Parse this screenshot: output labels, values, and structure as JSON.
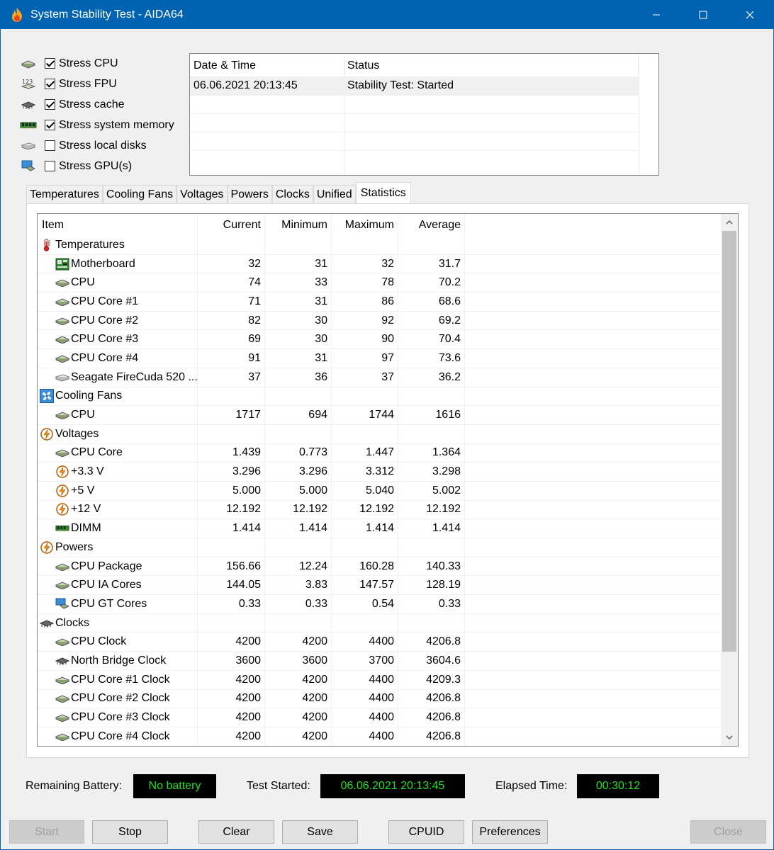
{
  "window": {
    "title": "System Stability Test - AIDA64",
    "controls": [
      "minimize-icon",
      "maximize-icon",
      "close-icon"
    ]
  },
  "stress": [
    {
      "label": "Stress CPU",
      "checked": true,
      "icon": "cpu-chip-icon"
    },
    {
      "label": "Stress FPU",
      "checked": true,
      "icon": "fpu-123-icon"
    },
    {
      "label": "Stress cache",
      "checked": true,
      "icon": "cache-chip-icon"
    },
    {
      "label": "Stress system memory",
      "checked": true,
      "icon": "memory-module-icon"
    },
    {
      "label": "Stress local disks",
      "checked": false,
      "icon": "disk-drive-icon"
    },
    {
      "label": "Stress GPU(s)",
      "checked": false,
      "icon": "gpu-monitor-icon"
    }
  ],
  "log": {
    "headers": [
      "Date & Time",
      "Status"
    ],
    "rows": [
      {
        "datetime": "06.06.2021 20:13:45",
        "status": "Stability Test: Started"
      }
    ]
  },
  "tabs": [
    "Temperatures",
    "Cooling Fans",
    "Voltages",
    "Powers",
    "Clocks",
    "Unified",
    "Statistics"
  ],
  "active_tab": "Statistics",
  "stats": {
    "headers": [
      "Item",
      "Current",
      "Minimum",
      "Maximum",
      "Average"
    ],
    "rows": [
      {
        "group": true,
        "icon": "thermometer-icon",
        "item": "Temperatures"
      },
      {
        "icon": "motherboard-icon",
        "item": "Motherboard",
        "cur": "32",
        "min": "31",
        "max": "32",
        "avg": "31.7"
      },
      {
        "icon": "cpu-chip-icon",
        "item": "CPU",
        "cur": "74",
        "min": "33",
        "max": "78",
        "avg": "70.2"
      },
      {
        "icon": "cpu-chip-icon",
        "item": "CPU Core #1",
        "cur": "71",
        "min": "31",
        "max": "86",
        "avg": "68.6"
      },
      {
        "icon": "cpu-chip-icon",
        "item": "CPU Core #2",
        "cur": "82",
        "min": "30",
        "max": "92",
        "avg": "69.2"
      },
      {
        "icon": "cpu-chip-icon",
        "item": "CPU Core #3",
        "cur": "69",
        "min": "30",
        "max": "90",
        "avg": "70.4"
      },
      {
        "icon": "cpu-chip-icon",
        "item": "CPU Core #4",
        "cur": "91",
        "min": "31",
        "max": "97",
        "avg": "73.6"
      },
      {
        "icon": "disk-drive-icon",
        "item": "Seagate FireCuda 520 ...",
        "cur": "37",
        "min": "36",
        "max": "37",
        "avg": "36.2"
      },
      {
        "group": true,
        "icon": "fan-icon",
        "item": "Cooling Fans"
      },
      {
        "icon": "cpu-chip-icon",
        "item": "CPU",
        "cur": "1717",
        "min": "694",
        "max": "1744",
        "avg": "1616"
      },
      {
        "group": true,
        "icon": "lightning-icon",
        "item": "Voltages"
      },
      {
        "icon": "cpu-chip-icon",
        "item": "CPU Core",
        "cur": "1.439",
        "min": "0.773",
        "max": "1.447",
        "avg": "1.364"
      },
      {
        "icon": "lightning-icon",
        "item": "+3.3 V",
        "cur": "3.296",
        "min": "3.296",
        "max": "3.312",
        "avg": "3.298"
      },
      {
        "icon": "lightning-icon",
        "item": "+5 V",
        "cur": "5.000",
        "min": "5.000",
        "max": "5.040",
        "avg": "5.002"
      },
      {
        "icon": "lightning-icon",
        "item": "+12 V",
        "cur": "12.192",
        "min": "12.192",
        "max": "12.192",
        "avg": "12.192"
      },
      {
        "icon": "memory-module-icon",
        "item": "DIMM",
        "cur": "1.414",
        "min": "1.414",
        "max": "1.414",
        "avg": "1.414"
      },
      {
        "group": true,
        "icon": "lightning-icon",
        "item": "Powers"
      },
      {
        "icon": "cpu-chip-icon",
        "item": "CPU Package",
        "cur": "156.66",
        "min": "12.24",
        "max": "160.28",
        "avg": "140.33"
      },
      {
        "icon": "cpu-chip-icon",
        "item": "CPU IA Cores",
        "cur": "144.05",
        "min": "3.83",
        "max": "147.57",
        "avg": "128.19"
      },
      {
        "icon": "gpu-monitor-icon",
        "item": "CPU GT Cores",
        "cur": "0.33",
        "min": "0.33",
        "max": "0.54",
        "avg": "0.33"
      },
      {
        "group": true,
        "icon": "cache-chip-icon",
        "item": "Clocks"
      },
      {
        "icon": "cpu-chip-icon",
        "item": "CPU Clock",
        "cur": "4200",
        "min": "4200",
        "max": "4400",
        "avg": "4206.8"
      },
      {
        "icon": "cache-chip-icon",
        "item": "North Bridge Clock",
        "cur": "3600",
        "min": "3600",
        "max": "3700",
        "avg": "3604.6"
      },
      {
        "icon": "cpu-chip-icon",
        "item": "CPU Core #1 Clock",
        "cur": "4200",
        "min": "4200",
        "max": "4400",
        "avg": "4209.3"
      },
      {
        "icon": "cpu-chip-icon",
        "item": "CPU Core #2 Clock",
        "cur": "4200",
        "min": "4200",
        "max": "4400",
        "avg": "4206.8"
      },
      {
        "icon": "cpu-chip-icon",
        "item": "CPU Core #3 Clock",
        "cur": "4200",
        "min": "4200",
        "max": "4400",
        "avg": "4206.8"
      },
      {
        "icon": "cpu-chip-icon",
        "item": "CPU Core #4 Clock",
        "cur": "4200",
        "min": "4200",
        "max": "4400",
        "avg": "4206.8"
      }
    ]
  },
  "status": {
    "battery_label": "Remaining Battery:",
    "battery_value": "No battery",
    "started_label": "Test Started:",
    "started_value": "06.06.2021 20:13:45",
    "elapsed_label": "Elapsed Time:",
    "elapsed_value": "00:30:12"
  },
  "buttons": {
    "start": "Start",
    "stop": "Stop",
    "clear": "Clear",
    "save": "Save",
    "cpuid": "CPUID",
    "preferences": "Preferences",
    "close": "Close"
  },
  "colors": {
    "titlebar": "#0063b1",
    "status_text": "#20e020",
    "status_bg": "#000000"
  }
}
